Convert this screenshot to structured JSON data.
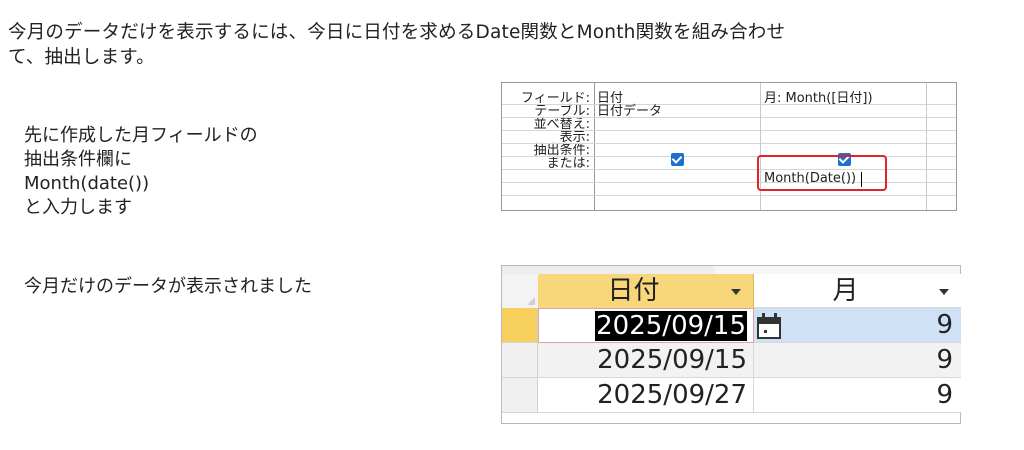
{
  "intro": {
    "line1": "今月のデータだけを表示するには、今日に日付を求めるDate関数とMonth関数を組み合わせ",
    "line2": "て、抽出します。"
  },
  "instructions": {
    "line1": "先に作成した月フィールドの",
    "line2": "抽出条件欄に",
    "line3": "Month(date())",
    "line4": "と入力します"
  },
  "result_note": "今月だけのデータが表示されました",
  "query_grid": {
    "row_labels": [
      "フィールド:",
      "テーブル:",
      "並べ替え:",
      "表示:",
      "抽出条件:",
      "または:"
    ],
    "col1": {
      "field": "日付",
      "table": "日付データ",
      "show": true
    },
    "col2": {
      "field": "月: Month([日付])",
      "show": true,
      "criteria": "Month(Date())"
    }
  },
  "datasheet": {
    "headers": [
      "日付",
      "月"
    ],
    "rows": [
      {
        "date": "2025/09/15",
        "month": "9"
      },
      {
        "date": "2025/09/15",
        "month": "9"
      },
      {
        "date": "2025/09/27",
        "month": "9"
      }
    ]
  },
  "colors": {
    "header_highlight": "#f8d77a",
    "criteria_box": "#e0242c",
    "checkbox": "#1f6fd0",
    "selected_cell": "#cfe2f5"
  }
}
